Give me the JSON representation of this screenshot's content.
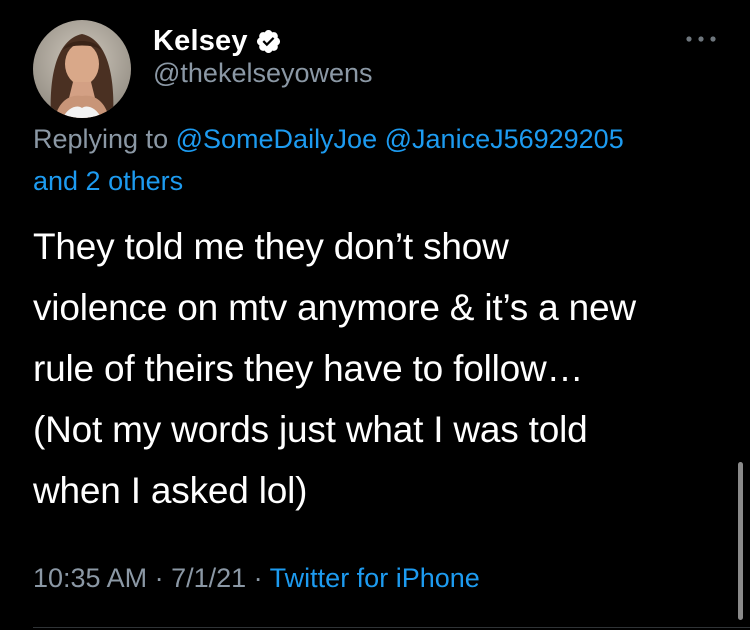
{
  "author": {
    "display_name": "Kelsey",
    "handle": "@thekelseyowens",
    "verified_icon": "verified-badge-icon",
    "avatar_icon": "profile-avatar"
  },
  "menu": {
    "icon": "more-options-icon"
  },
  "reply": {
    "prefix": "Replying to",
    "mentions": [
      "@SomeDailyJoe",
      "@JaniceJ56929205"
    ],
    "others": "and 2 others"
  },
  "tweet": {
    "text": "They told me they don’t show\nviolence on mtv anymore & it’s a new\nrule of theirs they have to follow…\n(Not my words just what I was told\nwhen I asked lol)"
  },
  "meta": {
    "time": "10:35 AM",
    "separator": " · ",
    "date": "7/1/21",
    "source": "Twitter for iPhone"
  },
  "colors": {
    "background": "#000000",
    "text": "#ffffff",
    "secondary": "#8b98a5",
    "link": "#1d9bf0"
  }
}
